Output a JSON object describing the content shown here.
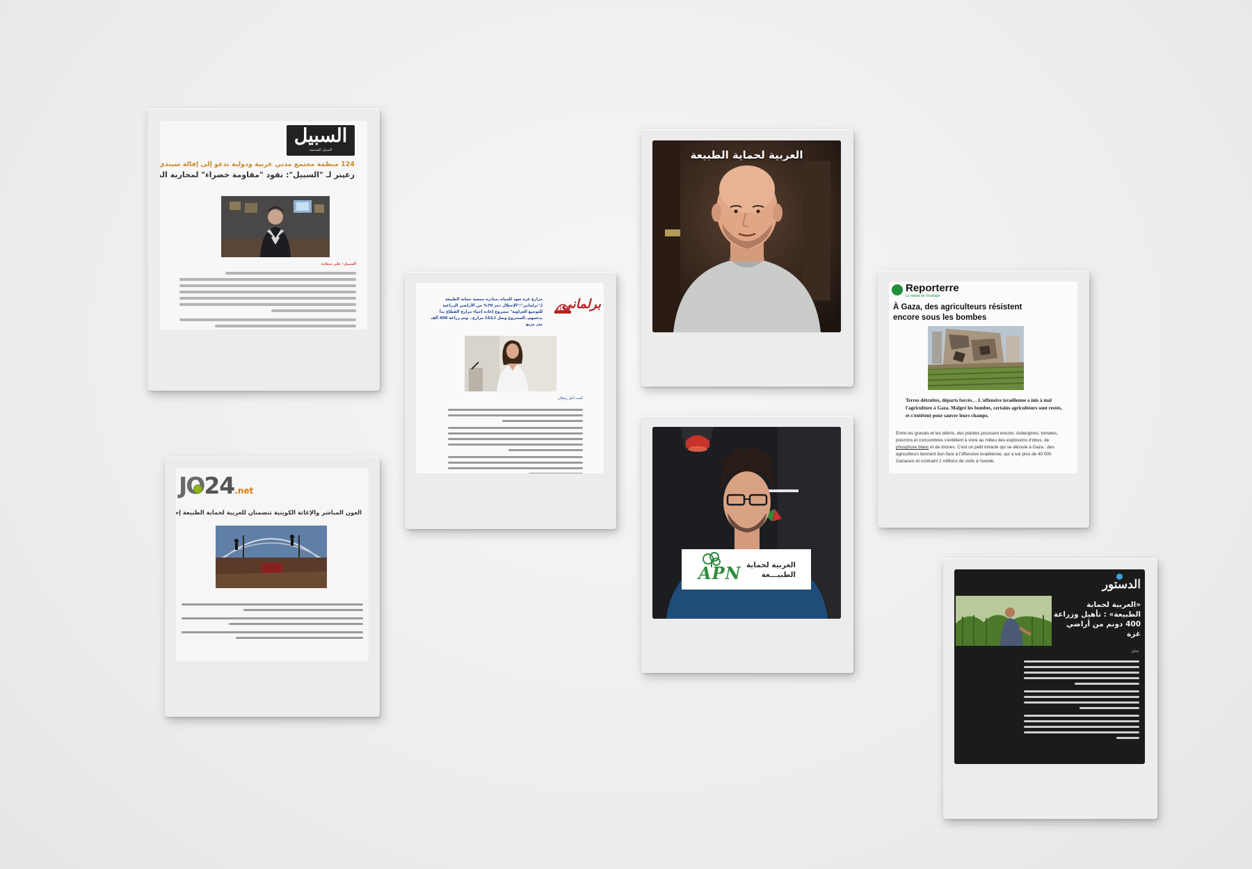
{
  "cards": {
    "assabeel": {
      "logo": "السبيل",
      "logo_tag": "السبيل الصحيفة",
      "kicker": "124 منظمة مجتمع مدني عربية ودولية تدعو إلى إقالة سيندي ماكين",
      "headline": "زعيتر لـ \"السبيل\": نقود \"مقاومة خضراء\" لمحاربة المجاعة في غزة",
      "byline": "السبيل- علي سعادة"
    },
    "jo24": {
      "logo_jo": "JO",
      "logo_24": "24",
      "logo_net": ".net",
      "headline": "العون المباشر والإغاثة الكويتية تتضمنان للعربية لحماية الطبيعة إحياء لمزارع غزة"
    },
    "barlamani": {
      "logo": "برلماني",
      "headline": "مزارع غزة تعود للحياة..مبادرة جمعية حماية الطبيعة لـ\"برلماني\":\"الإحتلال دمر 70% من الأراضي الزراعية للتوجيع الغزاوية\" مشروع إعادة إحياء مزارع القطاع بدأ بدعمهم..المشروع وصل لـ162 مزارع.. وتم زراعة 400 ألف متر مربع",
      "byline": "كتبت أمل رسلان"
    },
    "video1": {
      "caption": "العربية لحماية الطبيعة"
    },
    "video2": {
      "logo_text": "APN",
      "org_name_line1": "العربية لحماية",
      "org_name_line2": "الطبيـــعة"
    },
    "reporterre": {
      "logo": "Reporterre",
      "tagline": "Le média de l'écologie",
      "headline": "À Gaza, des agriculteurs résistent encore sous les bombes",
      "lead": "Terres détruites, départs forcés… L'offensive israélienne a mis à mal l'agriculture à Gaza. Malgré les bombes, certains agriculteurs sont restés, et s'entêtent pour sauver leurs champs.",
      "body_before_link": "Entre les gravats et les débris, des plantes poussent encore. Aubergines, tomates, poivrons et concombres s'entêtent à vivre au milieu des explosions d'obus, de ",
      "body_link": "phosphore blanc",
      "body_after_link": " et de drones. C'est un petit miracle qui se déroule à Gaza : des agriculteurs tiennent bon face à l'offensive israélienne, qui a tué plus de 40 000 Gazaouis et contraint 2 millions de civils à l'exode."
    },
    "addustour": {
      "logo": "الدستور",
      "headline": "«العربية لحماية الطبيعة» : تأهيل وزراعة 400 دونم من أراضي غزة",
      "dateline": "عمان"
    }
  },
  "colors": {
    "background": "#efefef",
    "frame": "#ececec",
    "assabeel_kicker": "#c98a2a",
    "barlamani_red": "#b22222",
    "barlamani_headline": "#1f3f8f",
    "jo24_green": "#8cb31a",
    "reporterre_green": "#1f8f3a",
    "apn_green": "#2e8b3d",
    "addustour_bg": "#1b1b1b"
  }
}
